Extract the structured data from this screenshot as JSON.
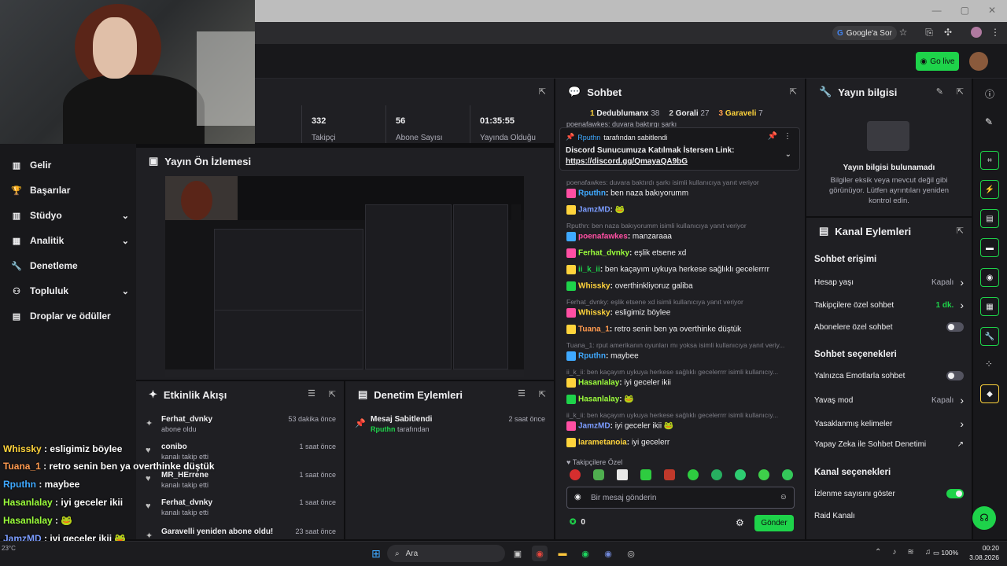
{
  "browser": {
    "google_btn": "Google'a Sor"
  },
  "topnav": {
    "go_live": "Go live"
  },
  "sidebar": {
    "items": [
      {
        "label": "Gelir",
        "icon": "revenue-icon",
        "chevron": false
      },
      {
        "label": "Başarılar",
        "icon": "trophy-icon",
        "chevron": false
      },
      {
        "label": "Stüdyo",
        "icon": "studio-icon",
        "chevron": true
      },
      {
        "label": "Analitik",
        "icon": "analytics-icon",
        "chevron": true
      },
      {
        "label": "Denetleme",
        "icon": "wrench-icon",
        "chevron": false
      },
      {
        "label": "Topluluk",
        "icon": "community-icon",
        "chevron": true
      },
      {
        "label": "Droplar ve ödüller",
        "icon": "drops-icon",
        "chevron": false
      }
    ]
  },
  "stats": [
    {
      "value": "332",
      "label": "Takipçi"
    },
    {
      "value": "56",
      "label": "Abone Sayısı"
    },
    {
      "value": "01:35:55",
      "label": "Yayında Olduğu Süre"
    }
  ],
  "preview": {
    "title": "Yayın Ön İzlemesi"
  },
  "activity": {
    "title": "Etkinlik Akışı",
    "items": [
      {
        "name": "Ferhat_dvnky",
        "sub": "abone oldu",
        "time": "53 dakika önce"
      },
      {
        "name": "conibo",
        "sub": "kanalı takip etti",
        "time": "1 saat önce"
      },
      {
        "name": "MR_HErrene",
        "sub": "kanalı takip etti",
        "time": "1 saat önce"
      },
      {
        "name": "Ferhat_dvnky",
        "sub": "kanalı takip etti",
        "time": "1 saat önce"
      },
      {
        "name": "Garavelli yeniden abone oldu!",
        "sub": "",
        "time": "23 saat önce"
      }
    ]
  },
  "moderation": {
    "title": "Denetim Eylemleri",
    "item": {
      "name": "Mesaj Sabitlendi",
      "user": "Rputhn",
      "suffix": " tarafından",
      "time": "2 saat önce"
    }
  },
  "chat": {
    "title": "Sohbet",
    "leaders": [
      {
        "rank": "1",
        "name": "Dedublumanx",
        "score": "38"
      },
      {
        "rank": "2",
        "name": "Gorali",
        "score": "27"
      },
      {
        "rank": "3",
        "name": "Garaveli",
        "score": "7"
      }
    ],
    "pinned": {
      "by": "Rputhn",
      "by_suffix": "tarafından sabitlendi",
      "text": "Discord Sunucumuza Katılmak İstersen Link:",
      "link": "https://discord.gg/QmayaQA9bG"
    },
    "partial_top": "poenafawkes: duvara baktırgı şarkı",
    "lines": [
      {
        "type": "reply",
        "text": "poenafawkes: duvara baktırdı şarkı isimli kullanıcıya yanıt veriyor"
      },
      {
        "type": "msg",
        "user": "Rputhn",
        "color": "#3fa9ff",
        "text": "ben naza bakıyorumm"
      },
      {
        "type": "msg",
        "user": "JamzMD",
        "color": "#7b9cff",
        "text": "🐸"
      },
      {
        "type": "reply",
        "text": "Rputhn: ben naza bakıyorumm isimli kullanıcıya yanıt veriyor"
      },
      {
        "type": "msg",
        "user": "poenafawkes",
        "color": "#ff4fa3",
        "text": "manzaraaa"
      },
      {
        "type": "msg",
        "user": "Ferhat_dvnky",
        "color": "#9cff3c",
        "text": "eşlik etsene xd"
      },
      {
        "type": "msg",
        "user": "ii_k_ii",
        "color": "#1ed34a",
        "text": "ben kaçayım uykuya herkese sağlıklı gecelerrrr"
      },
      {
        "type": "msg",
        "user": "Whissky",
        "color": "#ffd43c",
        "text": "overthinkliyoruz galiba"
      },
      {
        "type": "reply",
        "text": "Ferhat_dvnky: eşlik etsene xd isimli kullanıcıya yanıt veriyor"
      },
      {
        "type": "msg",
        "user": "Whissky",
        "color": "#ffd43c",
        "text": "esligimiz böylee"
      },
      {
        "type": "msg",
        "user": "Tuana_1",
        "color": "#ff9a4f",
        "text": "retro senin ben ya overthinke düştük"
      },
      {
        "type": "reply",
        "text": "Tuana_1: rput amerikanın oyunları mı yoksa isimli kullanıcıya yanıt veriy..."
      },
      {
        "type": "msg",
        "user": "Rputhn",
        "color": "#3fa9ff",
        "text": "maybee"
      },
      {
        "type": "reply",
        "text": "ii_k_ii: ben kaçayım uykuya herkese sağlıklı gecelerrrr isimli kullanıcıy..."
      },
      {
        "type": "msg",
        "user": "Hasanlalay",
        "color": "#9cff3c",
        "text": "iyi geceler ikii"
      },
      {
        "type": "msg",
        "user": "Hasanlalay",
        "color": "#9cff3c",
        "text": "🐸"
      },
      {
        "type": "reply",
        "text": "ii_k_ii: ben kaçayım uykuya herkese sağlıklı gecelerrrr isimli kullanıcıy..."
      },
      {
        "type": "msg",
        "user": "JamzMD",
        "color": "#7b9cff",
        "text": "iyi geceler ikii 🐸"
      },
      {
        "type": "msg",
        "user": "larametanoia",
        "color": "#ffd43c",
        "text": "iyi gecelerr"
      }
    ],
    "followers_only": "Takipçilere Özel",
    "input_placeholder": "Bir mesaj gönderin",
    "points": "0",
    "send": "Gönder"
  },
  "stream_info": {
    "title": "Yayın bilgisi",
    "empty_title": "Yayın bilgisi bulunamadı",
    "empty_text": "Bilgiler eksik veya mevcut değil gibi görünüyor. Lütfen ayrıntıları yeniden kontrol edin."
  },
  "channel_actions": {
    "title": "Kanal Eylemleri",
    "section1": "Sohbet erişimi",
    "rows1": [
      {
        "label": "Hesap yaşı",
        "value": "Kapalı",
        "control": "arrow"
      },
      {
        "label": "Takipçilere özel sohbet",
        "value": "1 dk.",
        "control": "arrow"
      },
      {
        "label": "Abonelere özel sohbet",
        "value": "",
        "control": "toggle-off"
      }
    ],
    "section2": "Sohbet seçenekleri",
    "rows2": [
      {
        "label": "Yalnızca Emotlarla sohbet",
        "value": "",
        "control": "toggle-off"
      },
      {
        "label": "Yavaş mod",
        "value": "Kapalı",
        "control": "arrow"
      },
      {
        "label": "Yasaklanmış kelimeler",
        "value": "",
        "control": "arrow"
      },
      {
        "label": "Yapay Zeka ile Sohbet Denetimi",
        "value": "",
        "control": "external"
      }
    ],
    "section3": "Kanal seçenekleri",
    "rows3": [
      {
        "label": "İzlenme sayısını göster",
        "value": "",
        "control": "toggle-on"
      },
      {
        "label": "Raid Kanalı",
        "value": "",
        "control": "none"
      }
    ]
  },
  "overlay_chat": [
    {
      "user": "Whissky",
      "color": "#ffd43c",
      "text": " : esligimiz böylee"
    },
    {
      "user": "Tuana_1",
      "color": "#ff9a4f",
      "text": " : retro senin ben ya overthinke düştük"
    },
    {
      "user": "Rputhn",
      "color": "#3fa9ff",
      "text": " : maybee"
    },
    {
      "user": "Hasanlalay",
      "color": "#9cff3c",
      "text": " : iyi geceler ikii"
    },
    {
      "user": "Hasanlalay",
      "color": "#9cff3c",
      "text": " : 🐸"
    },
    {
      "user": "JamzMD",
      "color": "#7b9cff",
      "text": " : iyi geceler ikii 🐸"
    },
    {
      "user": "larametanoia",
      "color": "#ffd43c",
      "text": " : iyi gecelerr"
    }
  ],
  "taskbar": {
    "search": "Ara",
    "weather": "23°C",
    "battery": "100%",
    "time": "00:20",
    "date": "3.08.2026"
  },
  "colors": {
    "accent": "#1ed34a",
    "bg": "#0e0e10",
    "panel": "#1f1f23"
  }
}
